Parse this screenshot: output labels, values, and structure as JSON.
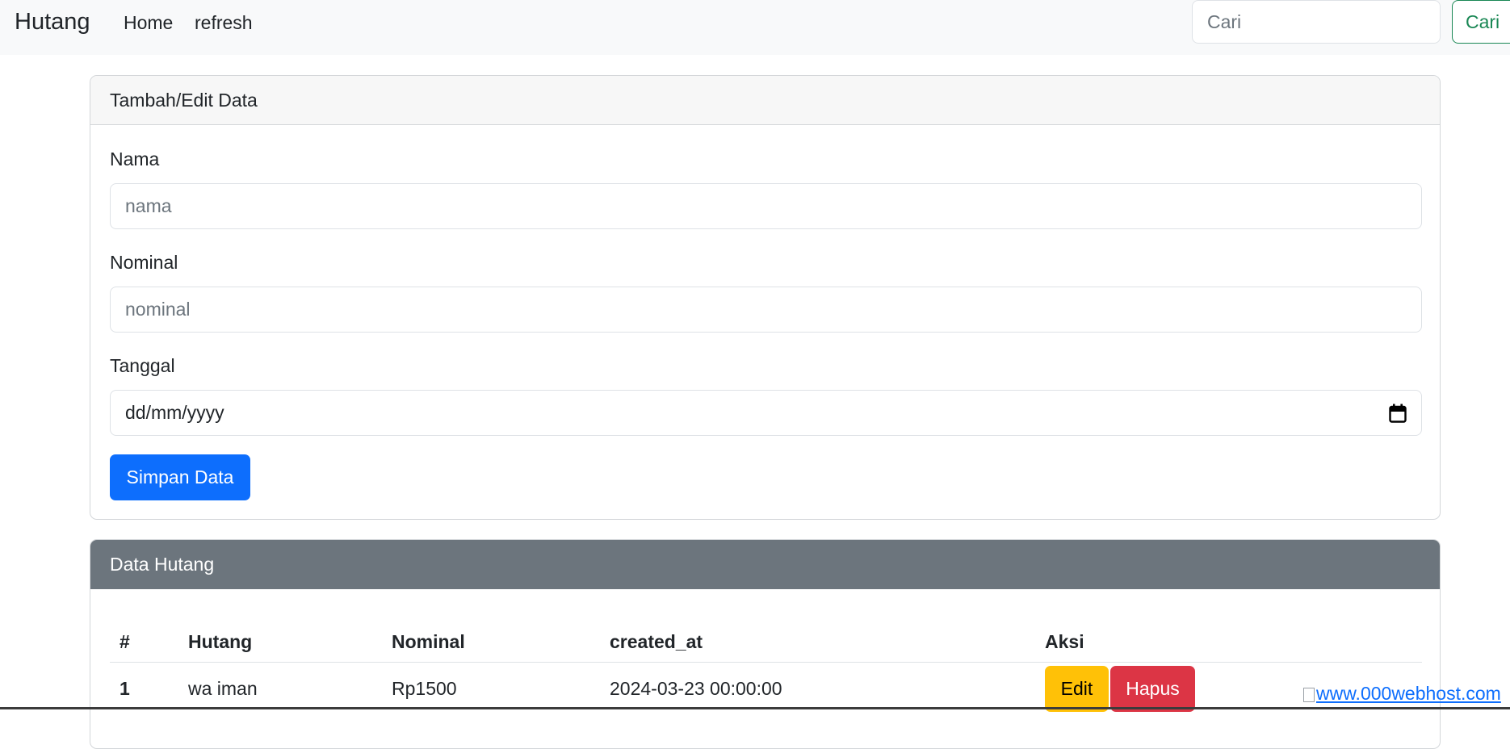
{
  "navbar": {
    "brand": "Hutang",
    "links": [
      "Home",
      "refresh"
    ],
    "search_placeholder": "Cari",
    "search_button": "Cari"
  },
  "form_card": {
    "header": "Tambah/Edit Data",
    "fields": [
      {
        "label": "Nama",
        "placeholder": "nama"
      },
      {
        "label": "Nominal",
        "placeholder": "nominal"
      },
      {
        "label": "Tanggal",
        "value": "dd/mm/yyyy"
      }
    ],
    "submit_label": "Simpan Data"
  },
  "table_card": {
    "header": "Data Hutang",
    "columns": [
      "#",
      "Hutang",
      "Nominal",
      "created_at",
      "Aksi"
    ],
    "rows": [
      {
        "num": "1",
        "hutang": "wa iman",
        "nominal": "Rp1500",
        "created_at": "2024-03-23 00:00:00",
        "edit_label": "Edit",
        "delete_label": "Hapus"
      }
    ]
  },
  "footer": {
    "host_link": "www.000webhost.com"
  },
  "colors": {
    "primary": "#0d6efd",
    "success": "#198754",
    "warning": "#ffc107",
    "danger": "#dc3545",
    "secondary": "#6c757d"
  }
}
